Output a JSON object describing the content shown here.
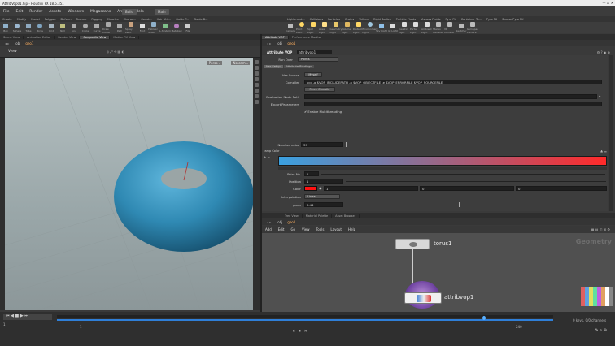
{
  "window": {
    "title": "AttribVop01.hip - Houdini FX 18.5.351",
    "controls": "—  ☐  ✕"
  },
  "menu": [
    "File",
    "Edit",
    "Render",
    "Assets",
    "Windows",
    "Megascans",
    "Arnold",
    "Help"
  ],
  "desktop": {
    "left": "Build",
    "right": "Main"
  },
  "shelf_tabs_left": [
    "Create",
    "Modify",
    "Model",
    "Polygon",
    "Deform",
    "Texture",
    "Rigging",
    "Muscles",
    "Charac...",
    "Const...",
    "Hair Util...",
    "Guide P...",
    "Guide B...",
    "Terrain...",
    "Simple...",
    "Cloud FX",
    "Volume",
    "TD Tools",
    "LAB SKE"
  ],
  "shelf_tabs_right": [
    "Lights and...",
    "Collisions",
    "Particles",
    "Grains",
    "Vellum",
    "Rigid Bodies",
    "Particle Fluids",
    "Viscous Fluids",
    "Pyro FX",
    "Container To...",
    "Pyro FX",
    "Sparse Pyro FX",
    "FEM",
    "Crowds",
    "Populate Co..."
  ],
  "tools_left": [
    "Box",
    "Sphere",
    "Tube",
    "Torus",
    "Grid",
    "Null",
    "Line",
    "Circle",
    "Curve",
    "Draw Curve",
    "Path",
    "Spray Paint",
    "Font",
    "Platonic Solids",
    "L-System",
    "Metaball",
    "File"
  ],
  "tools_right": [
    "Camera",
    "Point Light",
    "Spot Light",
    "Area Light",
    "Geometry Light",
    "Volume Light",
    "Distant Light",
    "Environment Light",
    "Sky Light",
    "GI Light",
    "Caustic Light",
    "Portal Light",
    "Ambient Light",
    "Stereo Camera",
    "VR Camera",
    "Switcher",
    "Gamepad Camera"
  ],
  "pane_tabs_left": [
    "Scene View",
    "Animation Editor",
    "Render View",
    "Composite View",
    "Motion FX View"
  ],
  "pane_tabs_right": [
    "Attribute VOP",
    "Performance Monitor"
  ],
  "path_left": {
    "obj": "obj",
    "node": "geo1"
  },
  "path_right": {
    "obj": "obj",
    "node": "geo1"
  },
  "viewport": {
    "view_label": "View",
    "persp": "Persp ▾",
    "cam": "No cam ▾"
  },
  "parm": {
    "node_type": "Attribute VOP",
    "node_name": "attribvop1",
    "run_over_label": "Run Over",
    "run_over": "Points",
    "tabs": [
      "Vex Setup",
      "Attribute Bindings"
    ],
    "vex_source_label": "Vex Source",
    "vex_source": "Myself",
    "compiler_label": "Compiler",
    "compiler": "vcc -q $VOP_INCLUDEPATH -o $VOP_OBJECTFILE -e $VOP_ERRORFILE $VOP_SOURCEFILE",
    "force_compile": "Force Compile",
    "eval_node_path": "Evaluation Node Path",
    "export_params": "Export Parameters",
    "multithread": "Enable Multithreading",
    "number_noise_label": "Number noise",
    "number_noise": "39",
    "ramp_label": "ramp Color",
    "point_no_label": "Point No.",
    "point_no": "1",
    "position_label": "Position",
    "position": "1",
    "color_label": "Color",
    "color_vals": [
      "1",
      "0",
      "0"
    ],
    "interp_label": "Interpolation",
    "interp": "Linear",
    "parm_label": "parm",
    "parm_value": "0.44"
  },
  "net": {
    "tabs": [
      "Tree View",
      "Material Palette",
      "Asset Browser"
    ],
    "menu": [
      "Add",
      "Edit",
      "Go",
      "View",
      "Tools",
      "Layout",
      "Help"
    ],
    "context": "Geometry",
    "nodes": {
      "torus": "torus1",
      "attrib": "attribvop1"
    }
  },
  "timeline": {
    "frame": "1",
    "start": "1",
    "end": "240",
    "fps": "24",
    "keys": "0 keys, 0/0 channels"
  },
  "colors": {
    "torus": "#2f89b3",
    "ramp_start": "#3aa0e0",
    "ramp_end": "#ff2a2a",
    "swatch": "#ff1010"
  }
}
